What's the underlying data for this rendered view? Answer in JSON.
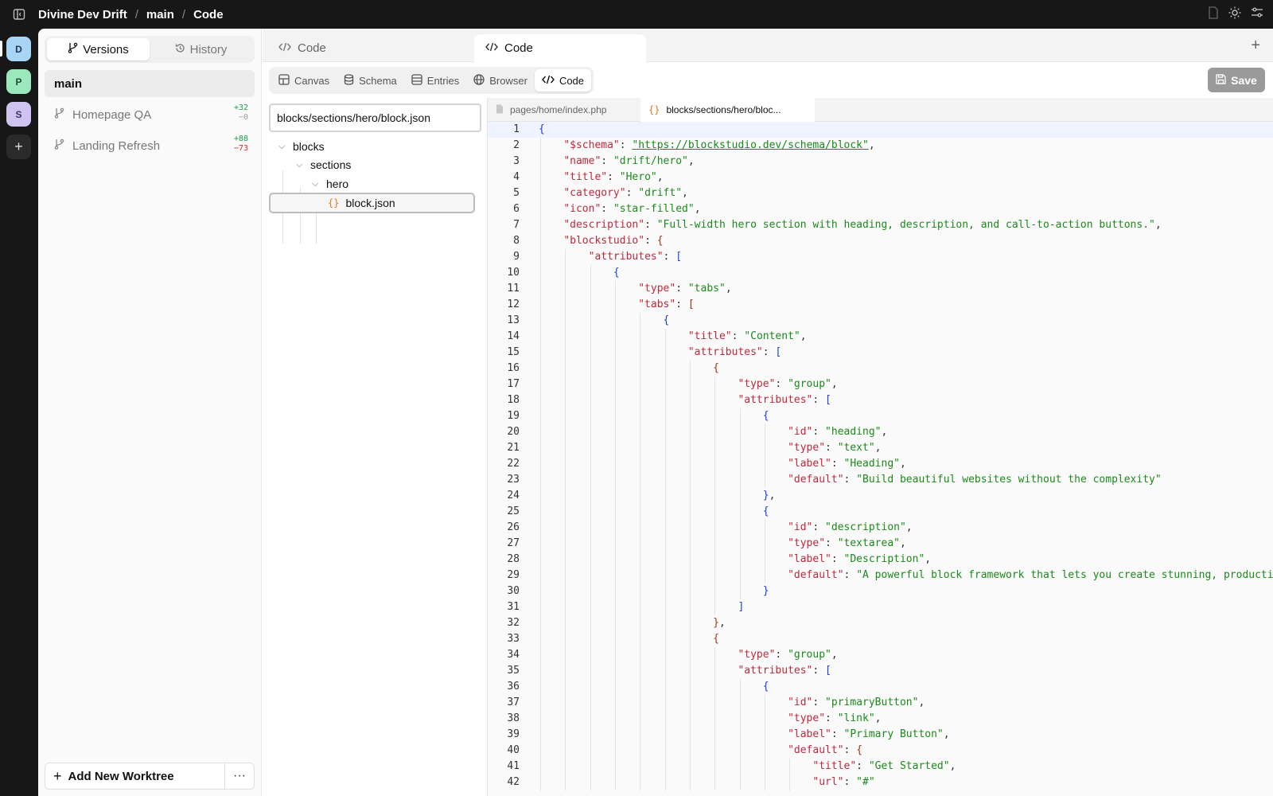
{
  "breadcrumb": {
    "project": "Divine Dev Drift",
    "branch": "main",
    "page": "Code",
    "sep": "/"
  },
  "rail": {
    "workspaces": [
      "D",
      "P",
      "S"
    ],
    "add": "+"
  },
  "sidebar": {
    "tabs": [
      {
        "label": "Versions"
      },
      {
        "label": "History"
      }
    ],
    "main_branch": "main",
    "worktrees": [
      {
        "name": "Homepage QA",
        "added": "+32",
        "removed": "−0"
      },
      {
        "name": "Landing Refresh",
        "added": "+88",
        "removed": "−73"
      }
    ],
    "footer": {
      "add_label": "Add New Worktree",
      "more": "···"
    }
  },
  "panel_tabs": [
    {
      "label": "Code"
    },
    {
      "label": "Code"
    }
  ],
  "tab_add": "+",
  "modes": [
    "Canvas",
    "Schema",
    "Entries",
    "Browser",
    "Code"
  ],
  "save_label": "Save",
  "file_tree": {
    "path_value": "blocks/sections/hero/block.json",
    "nodes": [
      "blocks",
      "sections",
      "hero",
      "block.json"
    ],
    "json_glyph": "{}"
  },
  "file_tabs": [
    {
      "label": "pages/home/index.php"
    },
    {
      "label": "blocks/sections/hero/bloc..."
    }
  ],
  "code_lines": [
    "{",
    "    \"$schema\": \"https://blockstudio.dev/schema/block\",",
    "    \"name\": \"drift/hero\",",
    "    \"title\": \"Hero\",",
    "    \"category\": \"drift\",",
    "    \"icon\": \"star-filled\",",
    "    \"description\": \"Full-width hero section with heading, description, and call-to-action buttons.\",",
    "    \"blockstudio\": {",
    "        \"attributes\": [",
    "            {",
    "                \"type\": \"tabs\",",
    "                \"tabs\": [",
    "                    {",
    "                        \"title\": \"Content\",",
    "                        \"attributes\": [",
    "                            {",
    "                                \"type\": \"group\",",
    "                                \"attributes\": [",
    "                                    {",
    "                                        \"id\": \"heading\",",
    "                                        \"type\": \"text\",",
    "                                        \"label\": \"Heading\",",
    "                                        \"default\": \"Build beautiful websites without the complexity\"",
    "                                    },",
    "                                    {",
    "                                        \"id\": \"description\",",
    "                                        \"type\": \"textarea\",",
    "                                        \"label\": \"Description\",",
    "                                        \"default\": \"A powerful block framework that lets you create stunning, producti",
    "                                    }",
    "                                ]",
    "                            },",
    "                            {",
    "                                \"type\": \"group\",",
    "                                \"attributes\": [",
    "                                    {",
    "                                        \"id\": \"primaryButton\",",
    "                                        \"type\": \"link\",",
    "                                        \"label\": \"Primary Button\",",
    "                                        \"default\": {",
    "                                            \"title\": \"Get Started\",",
    "                                            \"url\": \"#\""
  ],
  "colors": {
    "key": "#c0283b",
    "string": "#1a8a1a",
    "bracket": "#1d3fd6",
    "save_bg": "#9a9a9a"
  }
}
